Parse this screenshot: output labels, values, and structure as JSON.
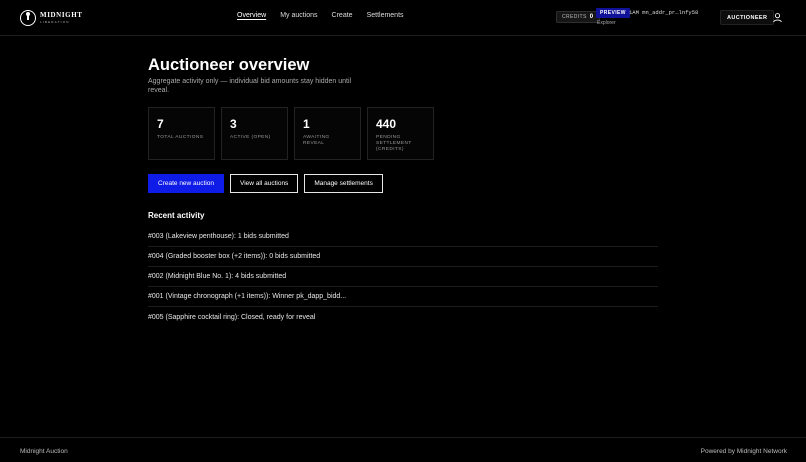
{
  "brand": {
    "name": "MIDNIGHT",
    "tagline": "LIBERATION"
  },
  "nav": {
    "items": [
      {
        "label": "Overview",
        "active": true
      },
      {
        "label": "My auctions",
        "active": false
      },
      {
        "label": "Create",
        "active": false
      },
      {
        "label": "Settlements",
        "active": false
      }
    ]
  },
  "header": {
    "credits_label": "CREDITS",
    "credits_value": "0",
    "preview_badge": "PREVIEW",
    "address": "1AM mn_addr_pr…lnfy58",
    "explorer_link": "Explorer",
    "role_button": "AUCTIONEER",
    "user_icon": "user-icon"
  },
  "main": {
    "title": "Auctioneer overview",
    "subtitle": "Aggregate activity only — individual bid amounts stay hidden until reveal."
  },
  "stats": [
    {
      "value": "7",
      "label": "TOTAL AUCTIONS"
    },
    {
      "value": "3",
      "label": "ACTIVE (OPEN)"
    },
    {
      "value": "1",
      "label": "AWAITING REVEAL"
    },
    {
      "value": "440",
      "label": "PENDING SETTLEMENT (CREDITS)"
    }
  ],
  "actions": {
    "create": "Create new auction",
    "view_all": "View all auctions",
    "manage": "Manage settlements"
  },
  "recent": {
    "title": "Recent activity",
    "items": [
      "#003 (Lakeview penthouse): 1 bids submitted",
      "#004 (Graded booster box (+2 items)): 0 bids submitted",
      "#002 (Midnight Blue No. 1): 4 bids submitted",
      "#001 (Vintage chronograph (+1 items)): Winner pk_dapp_bidd...",
      "#005 (Sapphire cocktail ring): Closed, ready for reveal"
    ]
  },
  "footer": {
    "left": "Midnight Auction",
    "right": "Powered by Midnight Network"
  },
  "colors": {
    "background": "#000000",
    "primary_button": "#0f1ce8",
    "preview_badge": "#10129a"
  }
}
